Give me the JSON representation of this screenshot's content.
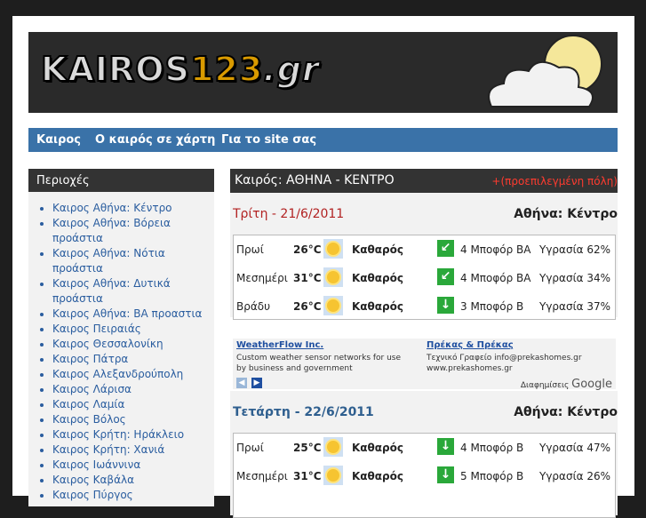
{
  "brand": {
    "logo_k": "KAIROS",
    "logo_n": "123",
    "logo_g": ".gr"
  },
  "nav": [
    "Καιρος",
    "Ο καιρός σε χάρτη",
    "Για το site σας"
  ],
  "sidebar": {
    "title": "Περιοχές",
    "items": [
      "Καιρος Αθήνα: Κέντρο",
      "Καιρος Αθήνα: Βόρεια προάστια",
      "Καιρος Αθήνα: Νότια προάστια",
      "Καιρος Αθήνα: Δυτικά προάστια",
      "Καιρος Αθήνα: ΒΑ προαστια",
      "Καιρος Πειραιάς",
      "Καιρος Θεσσαλονίκη",
      "Καιρος Πάτρα",
      "Καιρος Αλεξανδρούπολη",
      "Καιρος Λάρισα",
      "Καιρος Λαμία",
      "Καιρος Βόλος",
      "Καιρος Κρήτη: Ηράκλειο",
      "Καιρος Κρήτη: Χανιά",
      "Καιρος Ιωάννινα",
      "Καιρος Καβάλα",
      "Καιρος Πύργος"
    ]
  },
  "main": {
    "title": "Καιρός: ΑΘΗΝΑ - ΚΕΝΤΡΟ",
    "default_note": "+(προεπιλεγμένη πόλη)",
    "days": [
      {
        "date": "Τρίτη - 21/6/2011",
        "city": "Αθήνα: Κέντρο",
        "rows": [
          {
            "period": "Πρωί",
            "temp": "26°C",
            "sky": "Καθαρός",
            "arrow": "↙",
            "wind": "4 Μποφόρ ΒΑ",
            "humidity": "Υγρασία 62%"
          },
          {
            "period": "Μεσημέρι",
            "temp": "31°C",
            "sky": "Καθαρός",
            "arrow": "↙",
            "wind": "4 Μποφόρ ΒΑ",
            "humidity": "Υγρασία 34%"
          },
          {
            "period": "Βράδυ",
            "temp": "26°C",
            "sky": "Καθαρός",
            "arrow": "↓",
            "wind": "3 Μποφόρ Β",
            "humidity": "Υγρασία 37%"
          }
        ]
      },
      {
        "date": "Τετάρτη - 22/6/2011",
        "city": "Αθήνα: Κέντρο",
        "rows": [
          {
            "period": "Πρωί",
            "temp": "25°C",
            "sky": "Καθαρός",
            "arrow": "↓",
            "wind": "4 Μποφόρ Β",
            "humidity": "Υγρασία 47%"
          },
          {
            "period": "Μεσημέρι",
            "temp": "31°C",
            "sky": "Καθαρός",
            "arrow": "↓",
            "wind": "5 Μποφόρ Β",
            "humidity": "Υγρασία 26%"
          }
        ]
      }
    ]
  },
  "ads": {
    "ad1_title": "WeatherFlow Inc.",
    "ad1_text": "Custom weather sensor networks for use by business and government",
    "ad2_title": "Πρέκας & Πρέκας",
    "ad2_text": "Τεχνικό Γραφείο info@prekashomes.gr www.prekashomes.gr",
    "google_label": "Διαφημίσεις",
    "google_brand": "Google"
  },
  "colors": {
    "nav": "#3a72a8",
    "accent_red": "#b22222",
    "date_blue": "#2f5f8f",
    "wind_arrow": "#2aa83a"
  }
}
